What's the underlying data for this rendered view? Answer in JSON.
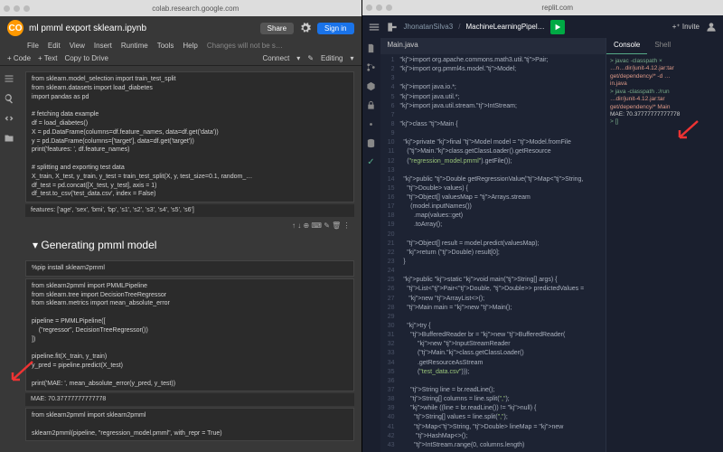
{
  "left": {
    "url": "colab.research.google.com",
    "filename": "ml pmml export sklearn.ipynb",
    "menu": [
      "File",
      "Edit",
      "View",
      "Insert",
      "Runtime",
      "Tools",
      "Help"
    ],
    "saved": "Changes will not be s…",
    "share": "Share",
    "signin": "Sign in",
    "toolbar": {
      "code": "+ Code",
      "text": "+ Text",
      "copy": "Copy to Drive",
      "connect": "Connect",
      "editing": "Editing"
    },
    "cell1": "from sklearn.model_selection import train_test_split\nfrom sklearn.datasets import load_diabetes\nimport pandas as pd\n\n# fetching data example\ndf = load_diabetes()\nX = pd.DataFrame(columns=df.feature_names, data=df.get('data'))\ny = pd.DataFrame(columns=['target'], data=df.get('target'))\nprint('features: ', df.feature_names)\n\n# splitting and exporting test data\nX_train, X_test, y_train, y_test = train_test_split(X, y, test_size=0.1, random_…\ndf_test = pd.concat([X_test, y_test], axis = 1)\ndf_test.to_csv('test_data.csv', index = False)",
    "out1": "features:  ['age', 'sex', 'bmi', 'bp', 's1', 's2', 's3', 's4', 's5', 's6']",
    "heading": "Generating pmml model",
    "cell2": "%pip install sklearn2pmml",
    "cell3": "from sklearn2pmml import PMMLPipeline\nfrom sklearn.tree import DecisionTreeRegressor\nfrom sklearn.metrics import mean_absolute_error\n\npipeline = PMMLPipeline([\n    (\"regressor\", DecisionTreeRegressor())\n])\n\npipeline.fit(X_train, y_train)\ny_pred = pipeline.predict(X_test)\n\nprint('MAE: ', mean_absolute_error(y_pred, y_test))",
    "out3": "MAE:  70.37777777777778",
    "cell4": "from sklearn2pmml import sklearn2pmml\n\nsklearn2pmml(pipeline, \"regression_model.pmml\", with_repr = True)"
  },
  "right": {
    "url": "replit.com",
    "user": "JhonatanSilva3",
    "proj": "MachineLearningPipel…",
    "invite": "Invite",
    "tab": "Main.java",
    "code": [
      "import org.apache.commons.math3.util.Pair;",
      "import org.pmml4s.model.Model;",
      "",
      "import java.io.*;",
      "import java.util.*;",
      "import java.util.stream.IntStream;",
      "",
      "class Main {",
      "",
      "  private final Model model = Model.fromFile",
      "    (Main.class.getClassLoader().getResource",
      "    (\"regression_model.pmml\").getFile());",
      "",
      "  public Double getRegressionValue(Map<String,",
      "    Double> values) {",
      "    Object[] valuesMap = Arrays.stream",
      "      (model.inputNames())",
      "        .map(values::get)",
      "        .toArray();",
      "",
      "    Object[] result = model.predict(valuesMap);",
      "    return (Double) result[0];",
      "  }",
      "",
      "  public static void main(String[] args) {",
      "    List<Pair<Double, Double>> predictedValues =",
      "     new ArrayList<>();",
      "    Main main = new Main();",
      "",
      "    try {",
      "      BufferedReader br = new BufferedReader(",
      "          new InputStreamReader",
      "          (Main.class.getClassLoader()",
      "          .getResourceAsStream",
      "          (\"test_data.csv\")));",
      "",
      "      String line = br.readLine();",
      "      String[] columns = line.split(\",\");",
      "      while ((line = br.readLine()) != null) {",
      "        String[] values = line.split(\",\");",
      "        Map<String, Double> lineMap = new",
      "         HashMap<>();",
      "        IntStream.range(0, columns.length)"
    ],
    "console": {
      "tabs": [
        "Console",
        "Shell"
      ],
      "lines": [
        {
          "c": "g",
          "t": "> javac -classpath ×"
        },
        {
          "c": "o",
          "t": "…n…dir/junit-4.12.jar:tar"
        },
        {
          "c": "o",
          "t": "get/dependency/* -d …"
        },
        {
          "c": "o",
          "t": "in.java"
        },
        {
          "c": "g",
          "t": "> java -classpath .:/run"
        },
        {
          "c": "o",
          "t": "…dir/junit-4.12.jar:tar"
        },
        {
          "c": "o",
          "t": "get/dependency/* Main"
        },
        {
          "c": "w",
          "t": "MAE: 70.37777777777778"
        },
        {
          "c": "g",
          "t": "> []"
        }
      ]
    }
  }
}
